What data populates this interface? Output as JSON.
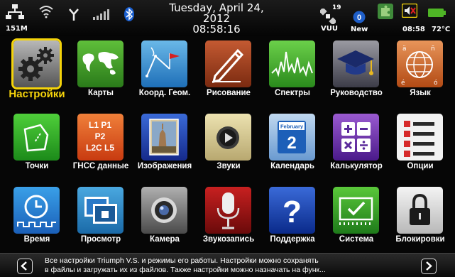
{
  "status_bar": {
    "network_label": "151M",
    "date": "Tuesday, April 24, 2012",
    "time": "08:58:16",
    "satellites_count": "19",
    "satellites_label": "VUU",
    "messages_label": "New",
    "clock": "08:58",
    "temperature": "72°C",
    "icons": [
      "network-icon",
      "wifi-icon",
      "antenna-icon",
      "signal-bars-icon",
      "bluetooth-icon",
      "satellite-icon",
      "messages-icon",
      "puzzle-icon",
      "speaker-muted-icon",
      "battery-icon"
    ]
  },
  "tiles": [
    {
      "label": "Настройки",
      "icon": "settings-gears-icon",
      "selected": true
    },
    {
      "label": "Карты",
      "icon": "world-map-icon"
    },
    {
      "label": "Коорд. Геом.",
      "icon": "coordinate-geometry-icon"
    },
    {
      "label": "Рисование",
      "icon": "pencil-drawing-icon"
    },
    {
      "label": "Спектры",
      "icon": "spectrum-icon"
    },
    {
      "label": "Руководство",
      "icon": "graduation-cap-icon"
    },
    {
      "label": "Язык",
      "icon": "globe-language-icon"
    },
    {
      "label": "Точки",
      "icon": "points-icon"
    },
    {
      "label": "ГНСС данные",
      "icon": "gnss-data-icon",
      "text_lines": [
        "L1 P1",
        "P2",
        "L2C L5"
      ]
    },
    {
      "label": "Изображения",
      "icon": "images-icon"
    },
    {
      "label": "Звуки",
      "icon": "sounds-icon"
    },
    {
      "label": "Календарь",
      "icon": "calendar-icon",
      "month": "February",
      "day": "2"
    },
    {
      "label": "Калькулятор",
      "icon": "calculator-icon"
    },
    {
      "label": "Опции",
      "icon": "options-checklist-icon"
    },
    {
      "label": "Время",
      "icon": "clock-time-icon"
    },
    {
      "label": "Просмотр",
      "icon": "view-screens-icon"
    },
    {
      "label": "Камера",
      "icon": "camera-icon"
    },
    {
      "label": "Звукозапись",
      "icon": "microphone-icon"
    },
    {
      "label": "Поддержка",
      "icon": "question-support-icon"
    },
    {
      "label": "Система",
      "icon": "system-screen-icon"
    },
    {
      "label": "Блокировки",
      "icon": "padlock-icon"
    }
  ],
  "help_bar": {
    "line1": "Все настройки Triumph V.S. и режимы его работы. Настройки можно сохранять",
    "line2": "в файлы и загружать их из файлов. Также настройки можно назначать на функ..."
  },
  "colors": {
    "selected": "#f4d30a",
    "background": "#060606"
  }
}
